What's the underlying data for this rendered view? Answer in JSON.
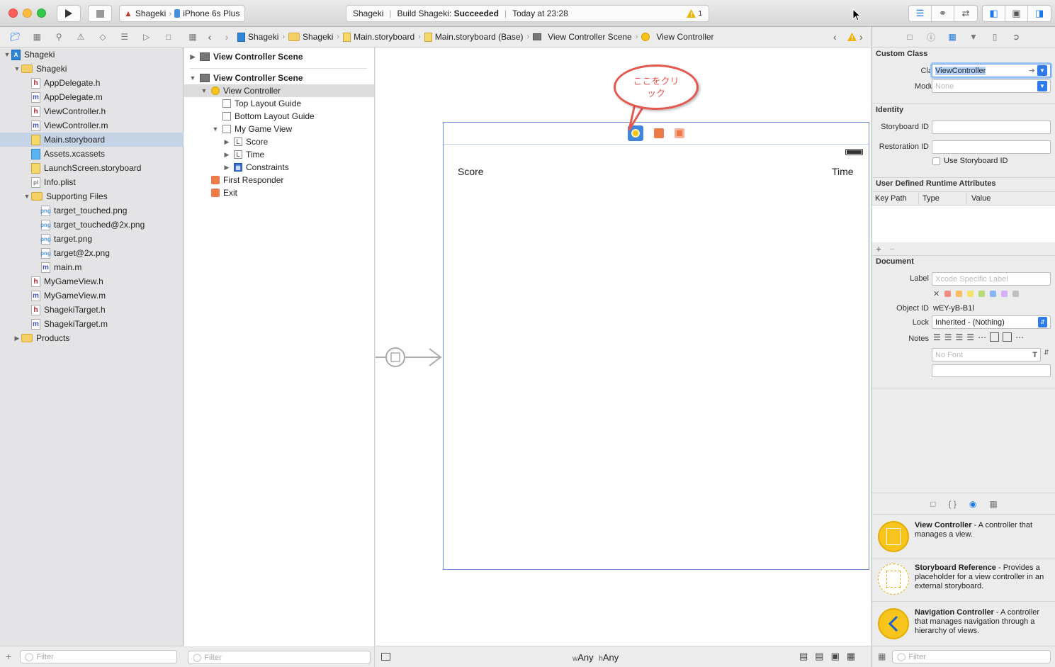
{
  "toolbar": {
    "scheme_project": "Shageki",
    "scheme_device": "iPhone 6s Plus",
    "activity_project": "Shageki",
    "activity_status_prefix": "Build Shageki:",
    "activity_status": "Succeeded",
    "activity_time": "Today at 23:28",
    "warning_count": "1"
  },
  "navigator": {
    "items": [
      {
        "label": "Shageki",
        "icon": "project",
        "level": 0,
        "expanded": true
      },
      {
        "label": "Shageki",
        "icon": "folder",
        "level": 1,
        "expanded": true
      },
      {
        "label": "AppDelegate.h",
        "icon": "h",
        "level": 2
      },
      {
        "label": "AppDelegate.m",
        "icon": "m",
        "level": 2
      },
      {
        "label": "ViewController.h",
        "icon": "h",
        "level": 2
      },
      {
        "label": "ViewController.m",
        "icon": "m",
        "level": 2
      },
      {
        "label": "Main.storyboard",
        "icon": "sb",
        "level": 2,
        "selected": true
      },
      {
        "label": "Assets.xcassets",
        "icon": "xc",
        "level": 2
      },
      {
        "label": "LaunchScreen.storyboard",
        "icon": "sb",
        "level": 2
      },
      {
        "label": "Info.plist",
        "icon": "plist",
        "level": 2
      },
      {
        "label": "Supporting Files",
        "icon": "folder",
        "level": 2,
        "expanded": true
      },
      {
        "label": "target_touched.png",
        "icon": "png",
        "level": 3
      },
      {
        "label": "target_touched@2x.png",
        "icon": "png",
        "level": 3
      },
      {
        "label": "target.png",
        "icon": "png",
        "level": 3
      },
      {
        "label": "target@2x.png",
        "icon": "png",
        "level": 3
      },
      {
        "label": "main.m",
        "icon": "m",
        "level": 3
      },
      {
        "label": "MyGameView.h",
        "icon": "h",
        "level": 2
      },
      {
        "label": "MyGameView.m",
        "icon": "m",
        "level": 2
      },
      {
        "label": "ShagekiTarget.h",
        "icon": "h",
        "level": 2
      },
      {
        "label": "ShagekiTarget.m",
        "icon": "m",
        "level": 2
      },
      {
        "label": "Products",
        "icon": "folder",
        "level": 1,
        "expanded": false
      }
    ],
    "filter_placeholder": "Filter"
  },
  "jumpbar": {
    "crumbs": [
      "Shageki",
      "Shageki",
      "Main.storyboard",
      "Main.storyboard (Base)",
      "View Controller Scene",
      "View Controller"
    ]
  },
  "outline": {
    "items": [
      {
        "label": "View Controller Scene",
        "icon": "scene",
        "level": 0,
        "header": true,
        "expanded": false
      },
      {
        "label": "View Controller Scene",
        "icon": "scene",
        "level": 0,
        "header": true,
        "expanded": true
      },
      {
        "label": "View Controller",
        "icon": "vc",
        "level": 1,
        "expanded": true,
        "selected": true
      },
      {
        "label": "Top Layout Guide",
        "icon": "guide",
        "level": 2
      },
      {
        "label": "Bottom Layout Guide",
        "icon": "guide",
        "level": 2
      },
      {
        "label": "My Game View",
        "icon": "view",
        "level": 2,
        "expanded": true
      },
      {
        "label": "Score",
        "icon": "label",
        "level": 3,
        "expanded": false
      },
      {
        "label": "Time",
        "icon": "label",
        "level": 3,
        "expanded": false
      },
      {
        "label": "Constraints",
        "icon": "cons",
        "level": 3,
        "expanded": false
      },
      {
        "label": "First Responder",
        "icon": "fr",
        "level": 1
      },
      {
        "label": "Exit",
        "icon": "exit",
        "level": 1
      }
    ],
    "filter_placeholder": "Filter"
  },
  "canvas": {
    "callout_text": "ここをクリック",
    "score_label": "Score",
    "time_label": "Time",
    "size_w_prefix": "w",
    "size_w": "Any",
    "size_h_prefix": "h",
    "size_h": "Any"
  },
  "inspector": {
    "custom_class": {
      "title": "Custom Class",
      "class_label": "Class",
      "class_value": "ViewController",
      "module_label": "Module",
      "module_placeholder": "None"
    },
    "identity": {
      "title": "Identity",
      "storyboard_id_label": "Storyboard ID",
      "restoration_id_label": "Restoration ID",
      "use_storyboard_id_label": "Use Storyboard ID"
    },
    "runtime_attributes": {
      "title": "User Defined Runtime Attributes",
      "columns": [
        "Key Path",
        "Type",
        "Value"
      ]
    },
    "document": {
      "title": "Document",
      "label_label": "Label",
      "label_placeholder": "Xcode Specific Label",
      "object_id_label": "Object ID",
      "object_id_value": "wEY-yB-B1l",
      "lock_label": "Lock",
      "lock_value": "Inherited - (Nothing)",
      "notes_label": "Notes",
      "font_placeholder": "No Font"
    },
    "library": {
      "items": [
        {
          "title": "View Controller",
          "desc": " - A controller that manages a view."
        },
        {
          "title": "Storyboard Reference",
          "desc": " - Provides a placeholder for a view controller in an external storyboard."
        },
        {
          "title": "Navigation Controller",
          "desc": " - A controller that manages navigation through a hierarchy of views."
        }
      ],
      "filter_placeholder": "Filter"
    }
  },
  "colors": {
    "accent": "#1b78e8",
    "callout": "#e5584f",
    "vc_yellow": "#f6c41b",
    "warning": "#f0b400",
    "label_colors": [
      "#f28b82",
      "#fbbc62",
      "#f7e26b",
      "#b6dc72",
      "#8ab4f8",
      "#d7aefb",
      "#c0c0c0"
    ]
  }
}
